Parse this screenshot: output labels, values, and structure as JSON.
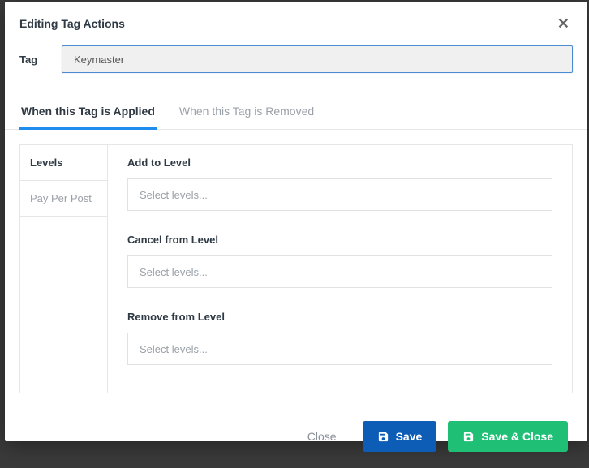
{
  "modal": {
    "title": "Editing Tag Actions",
    "close_label": "✕"
  },
  "tag": {
    "label": "Tag",
    "value": "Keymaster"
  },
  "tabs": {
    "applied": "When this Tag is Applied",
    "removed": "When this Tag is Removed"
  },
  "sidebar": {
    "items": [
      {
        "label": "Levels",
        "active": true
      },
      {
        "label": "Pay Per Post",
        "active": false
      }
    ]
  },
  "fields": {
    "add_level": {
      "label": "Add to Level",
      "placeholder": "Select levels..."
    },
    "cancel_level": {
      "label": "Cancel from Level",
      "placeholder": "Select levels..."
    },
    "remove_level": {
      "label": "Remove from Level",
      "placeholder": "Select levels..."
    }
  },
  "footer": {
    "close": "Close",
    "save": "Save",
    "save_close": "Save & Close"
  }
}
